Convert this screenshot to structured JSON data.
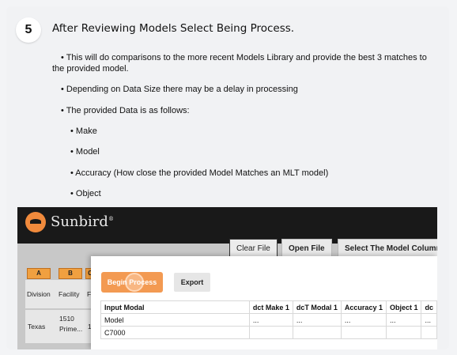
{
  "step": {
    "number": "5",
    "title": "After Reviewing Models Select Being Process."
  },
  "bullets": [
    "• This will do comparisons to the more recent Models Library and provide the best 3 matches to",
    "the provided model.",
    "• Depending on Data Size there may be a delay in processing",
    "• The provided Data is as follows:",
    "• Make",
    "• Model",
    "• Accuracy (How close the provided Model Matches an MLT model)",
    "• Object"
  ],
  "app": {
    "logo_text": "Sunbird",
    "logo_mark": "®",
    "toolbar": {
      "clear_file": "Clear File",
      "open_file": "Open File",
      "select_model_column": "Select The Model Column"
    },
    "grid": {
      "column_letters": [
        "A",
        "B",
        "C"
      ],
      "headers": [
        "Division",
        "Facility",
        "Fl"
      ],
      "row": [
        "Texas",
        "1510 Prime...",
        "1"
      ]
    },
    "dialog": {
      "begin_process": "Begin Process",
      "export": "Export",
      "table": {
        "headers": [
          "Input Modal",
          "dct Make 1",
          "dcT Modal 1",
          "Accuracy 1",
          "Object 1",
          "dc"
        ],
        "rows": [
          [
            "Model",
            "...",
            "...",
            "...",
            "...",
            "..."
          ],
          [
            "C7000",
            "",
            "",
            "",
            "",
            ""
          ]
        ]
      }
    }
  },
  "colors": {
    "accent_orange": "#f39a52",
    "header_dark": "#191919"
  }
}
